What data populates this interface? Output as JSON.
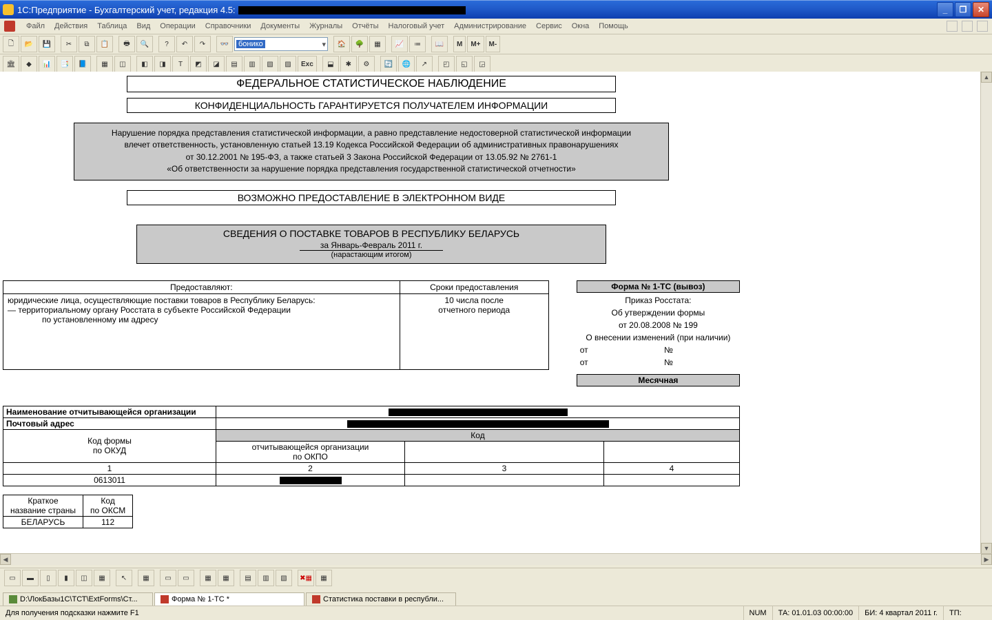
{
  "title": "1С:Предприятие - Бухгалтерский учет, редакция 4.5:",
  "menu": [
    "Файл",
    "Действия",
    "Таблица",
    "Вид",
    "Операции",
    "Справочники",
    "Документы",
    "Журналы",
    "Отчёты",
    "Налоговый учет",
    "Администрирование",
    "Сервис",
    "Окна",
    "Помощь"
  ],
  "toolbar1": {
    "search_selected": "бонико",
    "btns_m": [
      "М",
      "М+",
      "М-"
    ]
  },
  "toolbar2_exc": "Exc",
  "doc": {
    "header_title": "ФЕДЕРАЛЬНОЕ СТАТИСТИЧЕСКОЕ НАБЛЮДЕНИЕ",
    "header_conf": "КОНФИДЕНЦИАЛЬНОСТЬ ГАРАНТИРУЕТСЯ ПОЛУЧАТЕЛЕМ ИНФОРМАЦИИ",
    "warn_l1": "Нарушение порядка представления статистической информации, а равно представление недостоверной статистической информации",
    "warn_l2": "влечет ответственность, установленную статьей 13.19 Кодекса Российской Федерации об административных правонарушениях",
    "warn_l3": "от 30.12.2001 № 195-ФЗ, а также статьей 3 Закона Российской Федерации от 13.05.92 № 2761-1",
    "warn_l4": "«Об ответственности за нарушение порядка представления государственной статистической отчетности»",
    "eform": "ВОЗМОЖНО ПРЕДОСТАВЛЕНИЕ В ЭЛЕКТРОННОМ ВИДЕ",
    "sved_title": "СВЕДЕНИЯ О ПОСТАВКЕ ТОВАРОВ В РЕСПУБЛИКУ БЕЛАРУСЬ",
    "sved_period": "за Январь-Февраль  2011 г.",
    "sved_note": "(нарастающим итогом)",
    "provide_hdr_who": "Предоставляют:",
    "provide_hdr_when": "Сроки предоставления",
    "provide_who_l1": "юридические лица, осуществляющие поставки товаров в Республику Беларусь:",
    "provide_who_l2": "— территориальному органу Росстата в субъекте Российской Федерации",
    "provide_who_l3": "по установленному им адресу",
    "provide_when_l1": "10 числа после",
    "provide_when_l2": "отчетного периода",
    "form_no": "Форма № 1-ТС (вывоз)",
    "order_l1": "Приказ Росстата:",
    "order_l2": "Об утверждении формы",
    "order_l3": "от 20.08.2008 № 199",
    "order_l4": "О внесении изменений (при наличии)",
    "ot": "от",
    "num": "№",
    "monthly": "Месячная",
    "org_name_lbl": "Наименование отчитывающейся организации",
    "post_addr_lbl": "Почтовый адрес",
    "code_form_l1": "Код формы",
    "code_form_l2": "по ОКУД",
    "code_hdr": "Код",
    "okpo_l1": "отчитывающейся организации",
    "okpo_l2": "по ОКПО",
    "c1": "1",
    "c2": "2",
    "c3": "3",
    "c4": "4",
    "okud_val": "0613011",
    "country_l1": "Краткое",
    "country_l2": "название страны",
    "oksm_l1": "Код",
    "oksm_l2": "по ОКСМ",
    "country_val": "БЕЛАРУСЬ",
    "oksm_val": "112"
  },
  "wintabs": {
    "t1": "D:\\ЛокБазы1С\\ТСТ\\ExtForms\\Ст...",
    "t2": "Форма № 1-ТС  *",
    "t3": "Статистика поставки в республи..."
  },
  "status": {
    "hint": "Для получения подсказки нажмите F1",
    "num": "NUM",
    "ta": "ТА: 01.01.03  00:00:00",
    "bi": "БИ: 4 квартал 2011 г.",
    "tp": "ТП:"
  }
}
